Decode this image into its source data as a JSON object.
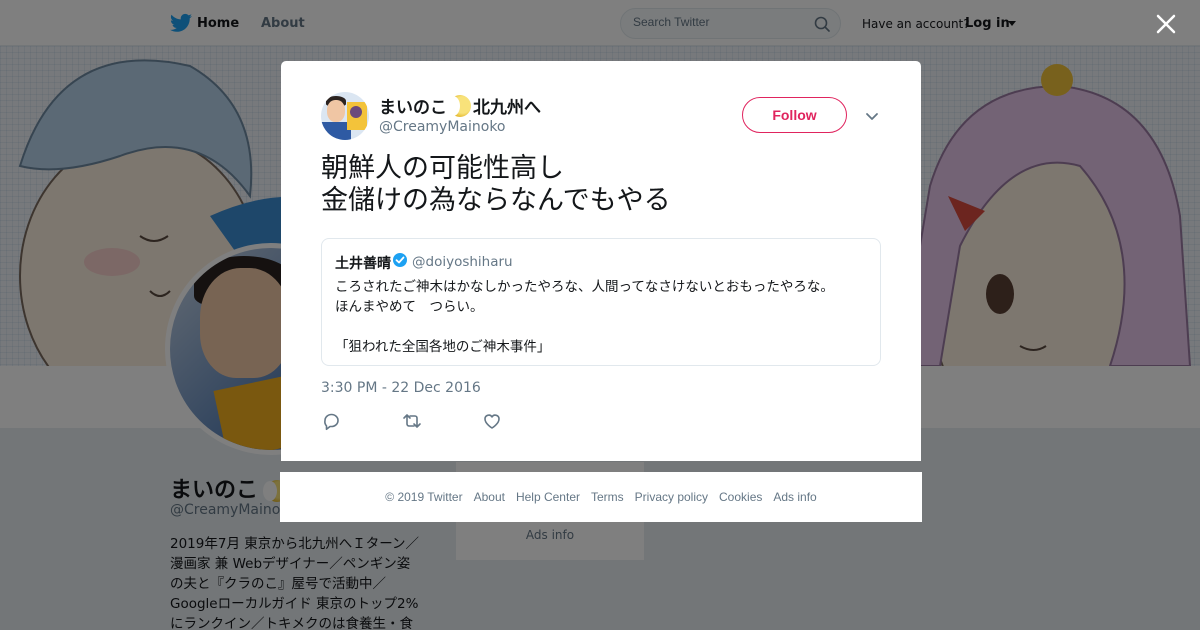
{
  "topnav": {
    "home_label": "Home",
    "about_label": "About",
    "search_placeholder": "Search Twitter",
    "have_account": "Have an account?",
    "login_label": "Log in"
  },
  "profile": {
    "name": "まいのこ",
    "handle": "@CreamyMainoko",
    "bio": [
      "2019年7月 東京から北九州へＩターン／",
      "漫画家 兼 Webデザイナー／ペンギン姿",
      "の夫と『クラのこ』屋号で活動中／",
      "Googleローカルガイド 東京のトップ2%",
      "にランクイン／トキメクのは食養生・食"
    ],
    "side_ads_info": "Ads info"
  },
  "tweet": {
    "author_name": "まいのこ",
    "author_name_suffix": "北九州へ",
    "author_handle": "@CreamyMainoko",
    "follow_label": "Follow",
    "text_lines": [
      "朝鮮人の可能性高し",
      "金儲けの為ならなんでもやる"
    ],
    "quoted": {
      "name": "土井善晴",
      "handle": "@doiyoshiharu",
      "line1": "ころされたご神木はかなしかったやろな、人間ってなさけないとおもったやろな。",
      "line2": "ほんまやめて　つらい。",
      "line3": "「狙われた全国各地のご神木事件」"
    },
    "timestamp": "3:30 PM - 22 Dec 2016"
  },
  "footer": {
    "copyright": "© 2019 Twitter",
    "about": "About",
    "help_center": "Help Center",
    "terms": "Terms",
    "privacy": "Privacy policy",
    "cookies": "Cookies",
    "ads_info": "Ads info"
  },
  "colors": {
    "twitter_blue": "#1da1f2",
    "follow_red": "#e0245e",
    "secondary_text": "#657786"
  },
  "icons": [
    "twitter-bird-icon",
    "search-icon",
    "close-icon",
    "chevron-down-icon",
    "reply-icon",
    "retweet-icon",
    "like-icon",
    "verified-badge-icon",
    "crescent-moon-emoji"
  ]
}
